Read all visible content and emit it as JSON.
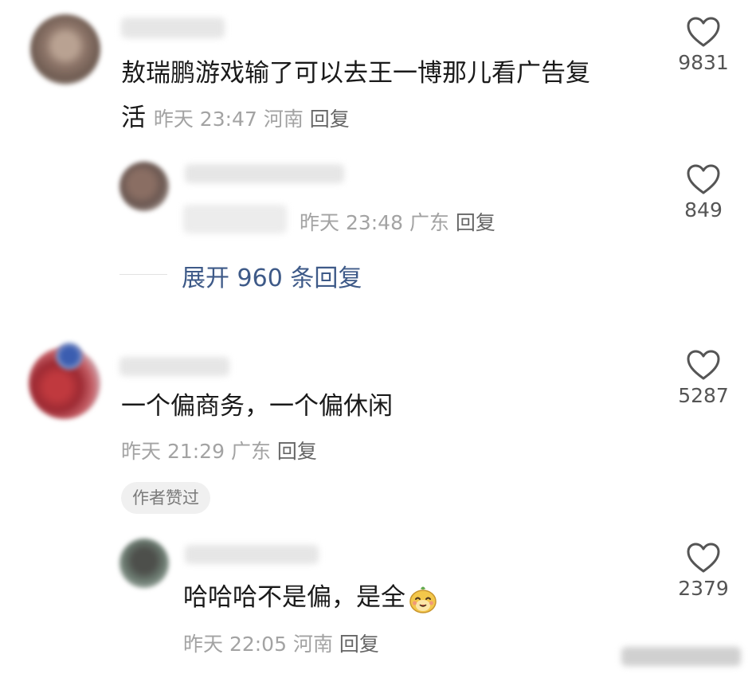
{
  "comments": [
    {
      "text_line1": "敖瑞鹏游戏输了可以去王一博那儿看广告复",
      "text_line2": "活",
      "time": "昨天 23:47",
      "location": "河南",
      "reply_label": "回复",
      "likes": "9831"
    },
    {
      "time": "昨天 23:48",
      "location": "广东",
      "reply_label": "回复",
      "likes": "849"
    },
    {
      "text": "一个偏商务，一个偏休闲",
      "time": "昨天 21:29",
      "location": "广东",
      "reply_label": "回复",
      "likes": "5287",
      "badge": "作者赞过"
    },
    {
      "text": "哈哈哈不是偏，是全",
      "time": "昨天 22:05",
      "location": "河南",
      "reply_label": "回复",
      "likes": "2379"
    }
  ],
  "expand_replies": "展开 960 条回复",
  "icons": {
    "like": "heart-outline-icon",
    "emoji": "smiling-creature-emoji-icon"
  },
  "colors": {
    "link": "#3e5a88",
    "meta": "#a3a3a3",
    "text": "#1a1a1a"
  }
}
